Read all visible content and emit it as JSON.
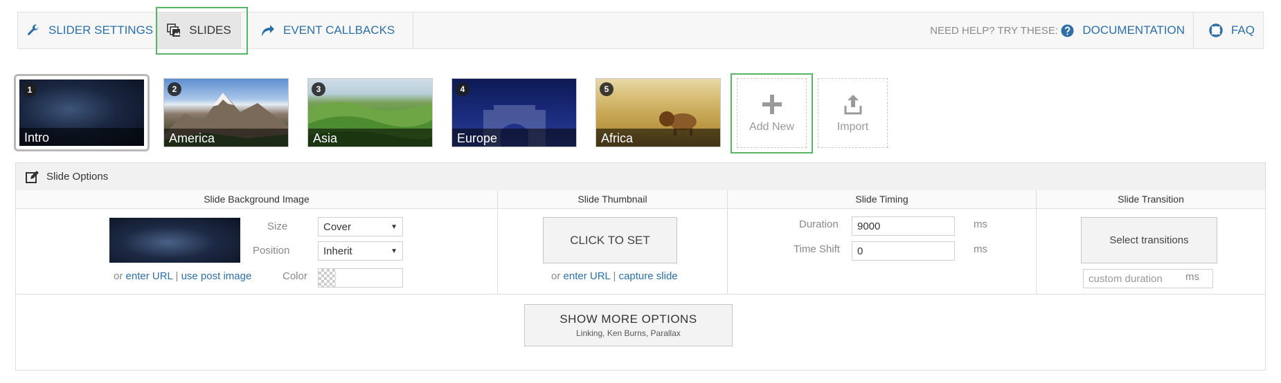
{
  "nav": {
    "slider_settings": "SLIDER SETTINGS",
    "slides": "SLIDES",
    "event_callbacks": "EVENT CALLBACKS",
    "help_text": "NEED HELP? TRY THESE:",
    "documentation": "DOCUMENTATION",
    "faq": "FAQ"
  },
  "slides": [
    {
      "num": "1",
      "label": "Intro",
      "active": true
    },
    {
      "num": "2",
      "label": "America"
    },
    {
      "num": "3",
      "label": "Asia"
    },
    {
      "num": "4",
      "label": "Europe"
    },
    {
      "num": "5",
      "label": "Africa"
    }
  ],
  "tiles": {
    "add_new": "Add New",
    "import": "Import"
  },
  "options": {
    "title": "Slide Options",
    "background": {
      "title": "Slide Background Image",
      "size_label": "Size",
      "size_value": "Cover",
      "position_label": "Position",
      "position_value": "Inherit",
      "color_label": "Color",
      "or": "or",
      "enter_url": "enter URL",
      "sep": "|",
      "use_post_image": "use post image"
    },
    "thumbnail": {
      "title": "Slide Thumbnail",
      "button": "CLICK TO SET",
      "or": "or",
      "enter_url": "enter URL",
      "sep": "|",
      "capture_slide": "capture slide"
    },
    "timing": {
      "title": "Slide Timing",
      "duration_label": "Duration",
      "duration_value": "9000",
      "timeshift_label": "Time Shift",
      "timeshift_value": "0",
      "unit": "ms"
    },
    "transition": {
      "title": "Slide Transition",
      "button": "Select transitions",
      "custom_placeholder": "custom duration",
      "unit": "ms"
    }
  },
  "more_options": {
    "label": "SHOW MORE OPTIONS",
    "sub": "Linking, Ken Burns, Parallax"
  },
  "colors": {
    "accent": "#2c6fa6",
    "highlight": "#57b566"
  },
  "icons": [
    "wrench-icon",
    "slides-icon",
    "callback-arrow-icon",
    "question-icon",
    "lifebuoy-icon",
    "plus-icon",
    "upload-icon",
    "edit-icon"
  ]
}
